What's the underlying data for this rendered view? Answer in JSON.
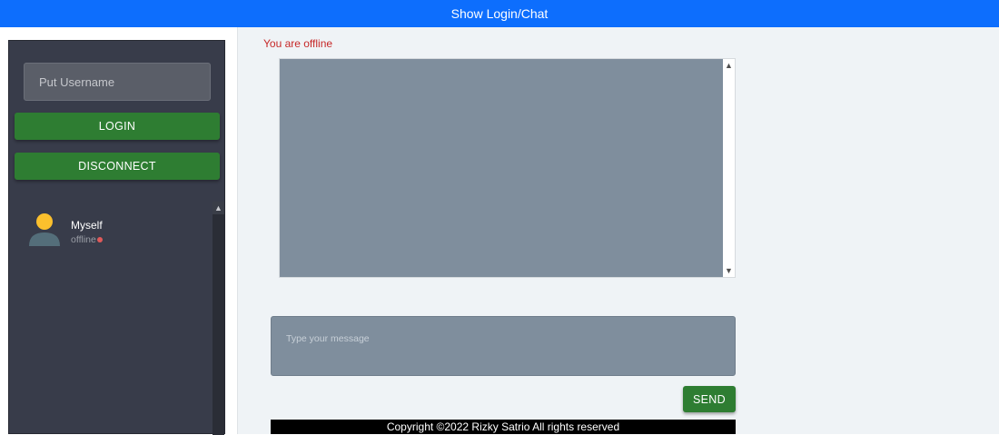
{
  "topbar": {
    "label": "Show Login/Chat"
  },
  "sidebar": {
    "username_placeholder": "Put Username",
    "login_label": "LOGIN",
    "disconnect_label": "DISCONNECT",
    "users": [
      {
        "name": "Myself",
        "status": "offline",
        "status_color": "#e05a5a",
        "avatar_head_color": "#fbc02d",
        "avatar_body_color": "#546e7a"
      }
    ]
  },
  "main": {
    "connection_status": "You are offline",
    "message_placeholder": "Type your message",
    "send_label": "SEND",
    "footer_text": "Copyright ©2022 Rizky Satrio All rights reserved"
  },
  "colors": {
    "topbar": "#0d6efd",
    "sidebar": "#383c4a",
    "button_green": "#2e7d32",
    "chat_bg": "#7f8e9d",
    "offline_text": "#c62828"
  }
}
